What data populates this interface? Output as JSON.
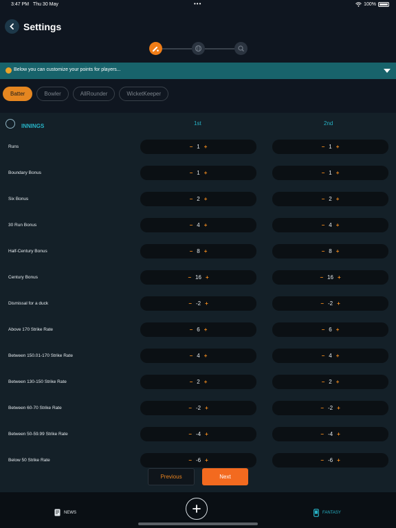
{
  "status_bar": {
    "time": "3:47 PM",
    "date": "Thu 30 May",
    "dots": "•••",
    "battery": "100%"
  },
  "header": {
    "title": "Settings"
  },
  "banner": {
    "text": "Below you can customize your points for players..."
  },
  "tabs": [
    {
      "label": "Batter",
      "active": true
    },
    {
      "label": "Bowler",
      "active": false
    },
    {
      "label": "AllRounder",
      "active": false
    },
    {
      "label": "WicketKeeper",
      "active": false
    }
  ],
  "section": {
    "title": "INNINGS",
    "col1": "1st",
    "col2": "2nd"
  },
  "controls": {
    "minus": "−",
    "plus": "+"
  },
  "rows": [
    {
      "label": "Runs",
      "v1": "1",
      "v2": "1"
    },
    {
      "label": "Boundary Bonus",
      "v1": "1",
      "v2": "1"
    },
    {
      "label": "Six Bonus",
      "v1": "2",
      "v2": "2"
    },
    {
      "label": "30 Run Bonus",
      "v1": "4",
      "v2": "4"
    },
    {
      "label": "Half-Century Bonus",
      "v1": "8",
      "v2": "8"
    },
    {
      "label": "Century Bonus",
      "v1": "16",
      "v2": "16"
    },
    {
      "label": "Dismissal for a duck",
      "v1": "-2",
      "v2": "-2"
    },
    {
      "label": "Above 170 Strike Rate",
      "v1": "6",
      "v2": "6"
    },
    {
      "label": "Between 150.01-170 Strike Rate",
      "v1": "4",
      "v2": "4"
    },
    {
      "label": "Between 130-150 Strike Rate",
      "v1": "2",
      "v2": "2"
    },
    {
      "label": "Between 60-70 Strike Rate",
      "v1": "-2",
      "v2": "-2"
    },
    {
      "label": "Between 50-59.99 Strike Rate",
      "v1": "-4",
      "v2": "-4"
    },
    {
      "label": "Below 50 Strike Rate",
      "v1": "-6",
      "v2": "-6"
    }
  ],
  "buttons": {
    "previous": "Previous",
    "next": "Next"
  },
  "bottom_nav": {
    "news": "NEWS",
    "fantasy": "FANTASY"
  },
  "colors": {
    "accent": "#f07d17",
    "teal": "#27b3c6",
    "banner": "#18636b"
  }
}
